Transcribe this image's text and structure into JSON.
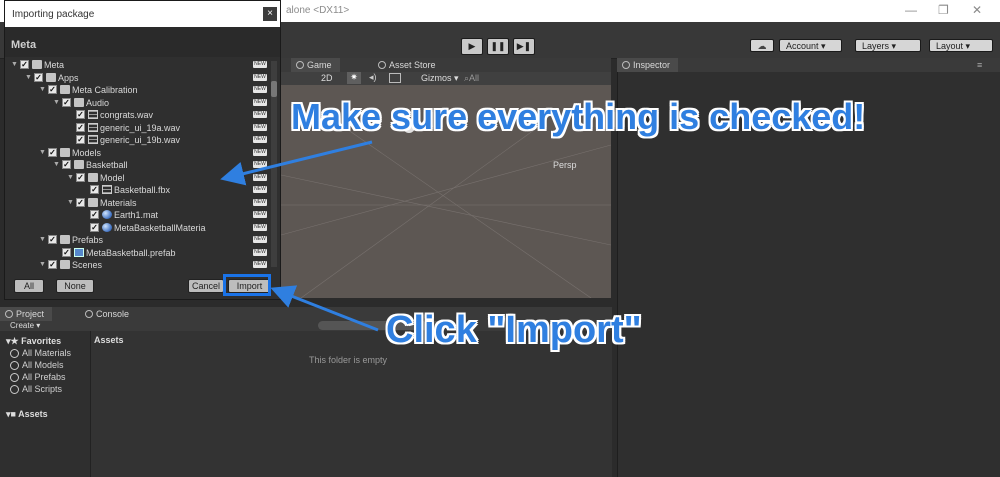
{
  "window": {
    "title_fragment": "alone <DX11>",
    "controls": [
      "—",
      "❐",
      "✕"
    ]
  },
  "toolbar": {
    "play": "▶",
    "pause": "❚❚",
    "step": "▶❚",
    "account": "Account",
    "layers": "Layers",
    "layout": "Layout"
  },
  "game_panel": {
    "tabs": [
      "Game",
      "Asset Store"
    ],
    "toggle_2d": "2D",
    "gizmos": "Gizmos",
    "search_all": "All",
    "persp": "Persp"
  },
  "inspector": {
    "tab": "Inspector"
  },
  "dialog": {
    "title": "Importing package",
    "close": "×",
    "header": "Meta",
    "new_badge": "NEW",
    "tree": [
      {
        "label": "Meta",
        "icon": "folder"
      },
      {
        "label": "Apps",
        "icon": "folder"
      },
      {
        "label": "Meta Calibration",
        "icon": "folder"
      },
      {
        "label": "Audio",
        "icon": "folder"
      },
      {
        "label": "congrats.wav",
        "icon": "file"
      },
      {
        "label": "generic_ui_19a.wav",
        "icon": "file"
      },
      {
        "label": "generic_ui_19b.wav",
        "icon": "file"
      },
      {
        "label": "Models",
        "icon": "folder"
      },
      {
        "label": "Basketball",
        "icon": "folder"
      },
      {
        "label": "Model",
        "icon": "folder"
      },
      {
        "label": "Basketball.fbx",
        "icon": "file"
      },
      {
        "label": "Materials",
        "icon": "folder"
      },
      {
        "label": "Earth1.mat",
        "icon": "sphere"
      },
      {
        "label": "MetaBasketballMateria",
        "icon": "sphere"
      },
      {
        "label": "Prefabs",
        "icon": "folder"
      },
      {
        "label": "MetaBasketball.prefab",
        "icon": "cube"
      },
      {
        "label": "Scenes",
        "icon": "folder"
      }
    ],
    "buttons": {
      "all": "All",
      "none": "None",
      "cancel": "Cancel",
      "import": "Import"
    }
  },
  "project": {
    "tabs": [
      "Project",
      "Console"
    ],
    "create": "Create",
    "favorites": "Favorites",
    "fav_items": [
      "All Materials",
      "All Models",
      "All Prefabs",
      "All Scripts"
    ],
    "assets_left": "Assets",
    "assets_header": "Assets",
    "empty": "This folder is empty"
  },
  "annotations": {
    "check_note": "Make sure everything is checked!",
    "import_note": "Click \"Import\""
  },
  "colors": {
    "annotation": "#2f7fe0",
    "highlight": "#1a73e8"
  }
}
